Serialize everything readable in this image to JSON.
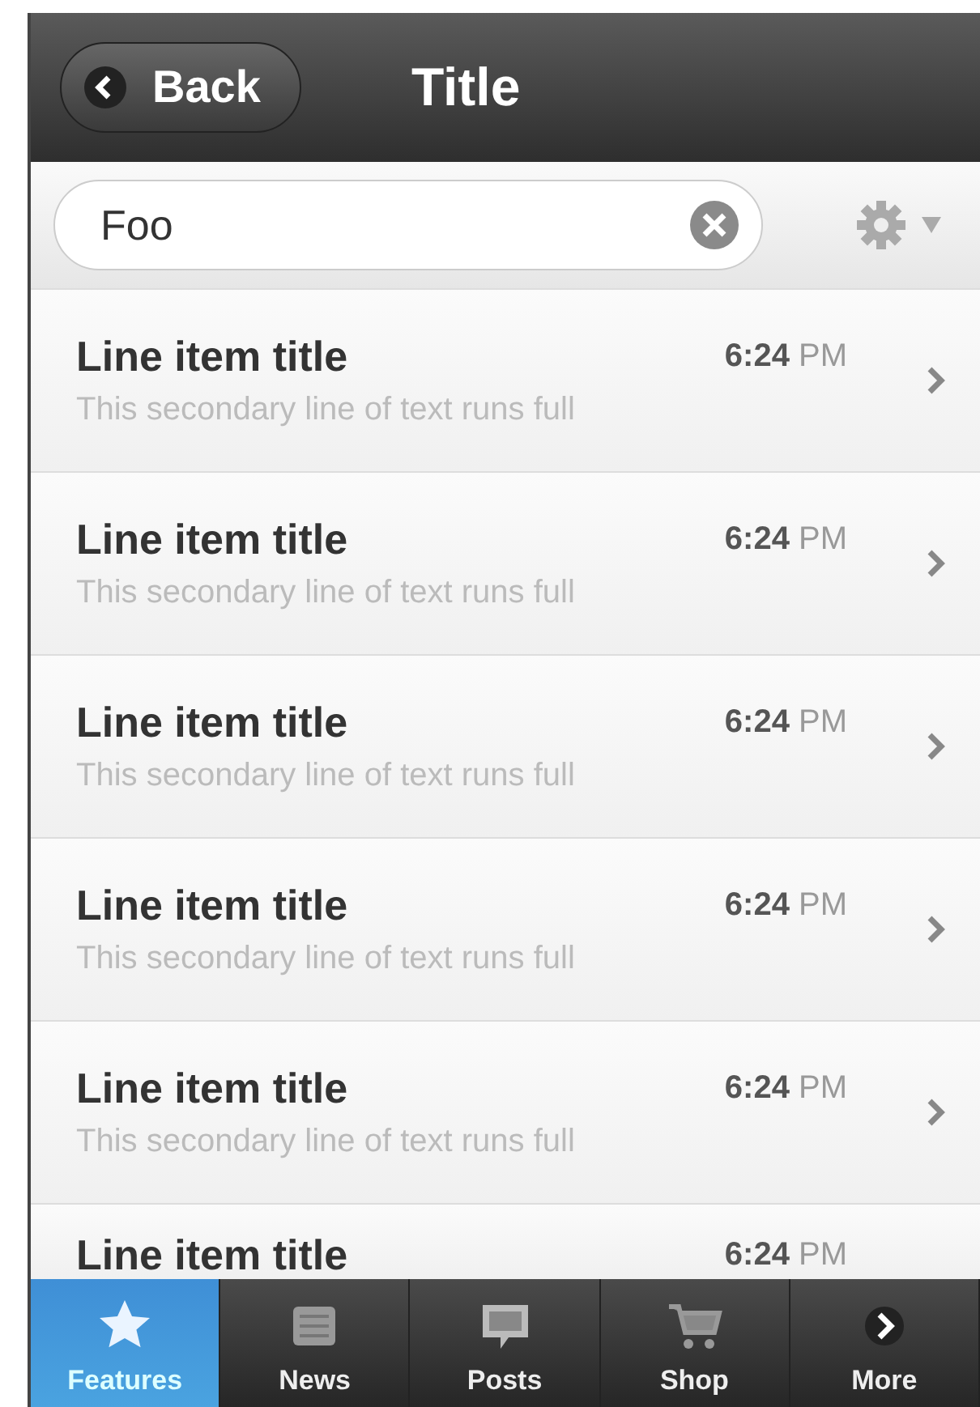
{
  "header": {
    "back_button": "Back",
    "title": "Title"
  },
  "search": {
    "value": "Foo"
  },
  "list": [
    {
      "title": "Line item title",
      "time": "**6:24** PM",
      "subtitle": "This secondary line of text runs full"
    },
    {
      "title": "Line item title",
      "time": "**6:24** PM",
      "subtitle": "This secondary line of text runs full"
    },
    {
      "title": "Line item title",
      "time": "**6:24** PM",
      "subtitle": "This secondary line of text runs full"
    },
    {
      "title": "Line item title",
      "time": "**6:24** PM",
      "subtitle": "This secondary line of text runs full"
    },
    {
      "title": "Line item title",
      "time": "**6:24** PM",
      "subtitle": "This secondary line of text runs full"
    },
    {
      "title": "Line item title",
      "time": "**6:24** PM"
    }
  ],
  "tab_bar": [
    {
      "kind": "star",
      "label": "Features",
      "selected": true
    },
    {
      "kind": "news",
      "label": "News",
      "selected": false
    },
    {
      "kind": "posts",
      "label": "Posts",
      "selected": false
    },
    {
      "kind": "shop",
      "label": "Shop",
      "selected": false
    },
    {
      "kind": "more",
      "label": "More",
      "selected": false
    }
  ]
}
